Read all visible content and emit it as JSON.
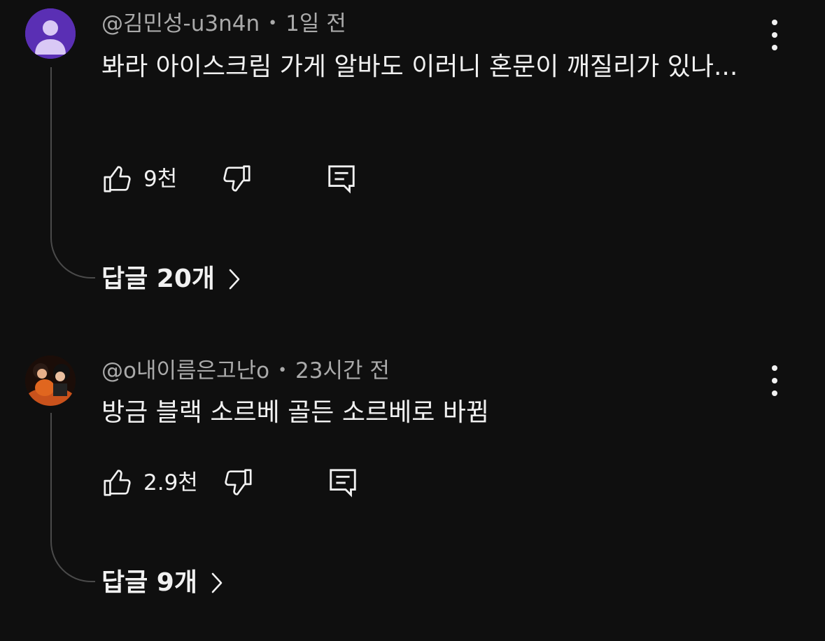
{
  "comments": [
    {
      "author": "@김민성-u3n4n",
      "time": "1일 전",
      "text": "봐라 아이스크림 가게 알바도 이러니 혼문이 깨질리가 있나...",
      "likes": "9천",
      "replies_label": "답글 20개"
    },
    {
      "author": "@o내이름은고난o",
      "time": "23시간 전",
      "text": "방금 블랙 소르베 골든 소르베로 바뀜",
      "likes": "2.9천",
      "replies_label": "답글 9개"
    }
  ],
  "icons": {
    "more": "more-vert-icon",
    "like": "thumb-up-icon",
    "dislike": "thumb-down-icon",
    "reply": "reply-comment-icon",
    "chevron": "chevron-right-icon"
  },
  "colors": {
    "background": "#0f0f0f",
    "text": "#f1f1f1",
    "secondary_text": "#aaaaaa",
    "avatar_default": "#5a2fb4"
  }
}
